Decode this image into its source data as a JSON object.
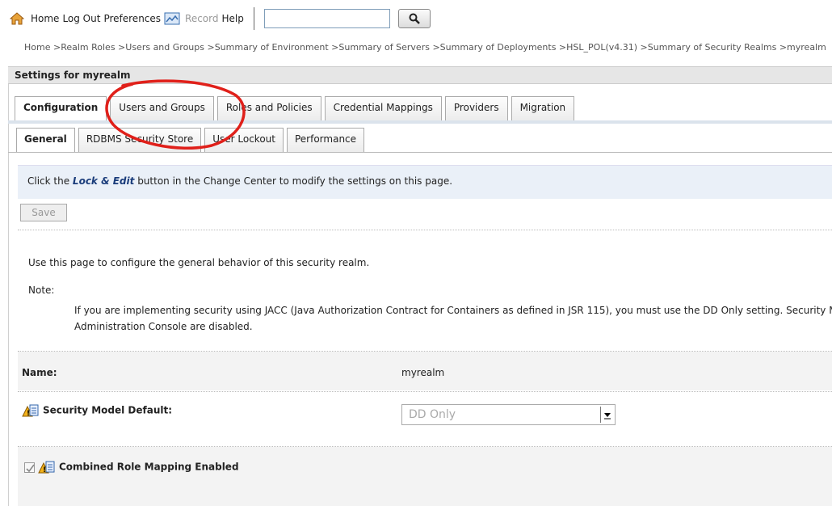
{
  "toolbar": {
    "home": "Home",
    "logout": "Log Out",
    "preferences": "Preferences",
    "record": "Record",
    "help": "Help",
    "search_value": ""
  },
  "breadcrumb": "Home >Realm Roles >Users and Groups >Summary of Environment >Summary of Servers >Summary of Deployments >HSL_POL(v4.31) >Summary of Security Realms >myrealm",
  "settings_title": "Settings for myrealm",
  "tabs_primary": [
    "Configuration",
    "Users and Groups",
    "Roles and Policies",
    "Credential Mappings",
    "Providers",
    "Migration"
  ],
  "tabs_secondary": [
    "General",
    "RDBMS Security Store",
    "User Lockout",
    "Performance"
  ],
  "notice": {
    "prefix": "Click the ",
    "link": "Lock & Edit",
    "suffix": " button in the Change Center to modify the settings on this page."
  },
  "save_label": "Save",
  "intro": "Use this page to configure the general behavior of this security realm.",
  "note_label": "Note:",
  "note_line1": "If you are implementing security using JACC (Java Authorization Contract for Containers as defined in JSR 115), you must use the DD Only setting. Security Model Default settings in the",
  "note_line2": "Administration Console are disabled.",
  "name_label": "Name:",
  "name_value": "myrealm",
  "security_model_label": "Security Model Default:",
  "security_model_value": "DD Only",
  "combined_label": "Combined Role Mapping Enabled",
  "colors": {
    "notice_bg": "#eaf0f8",
    "annotation": "#e0201a"
  }
}
